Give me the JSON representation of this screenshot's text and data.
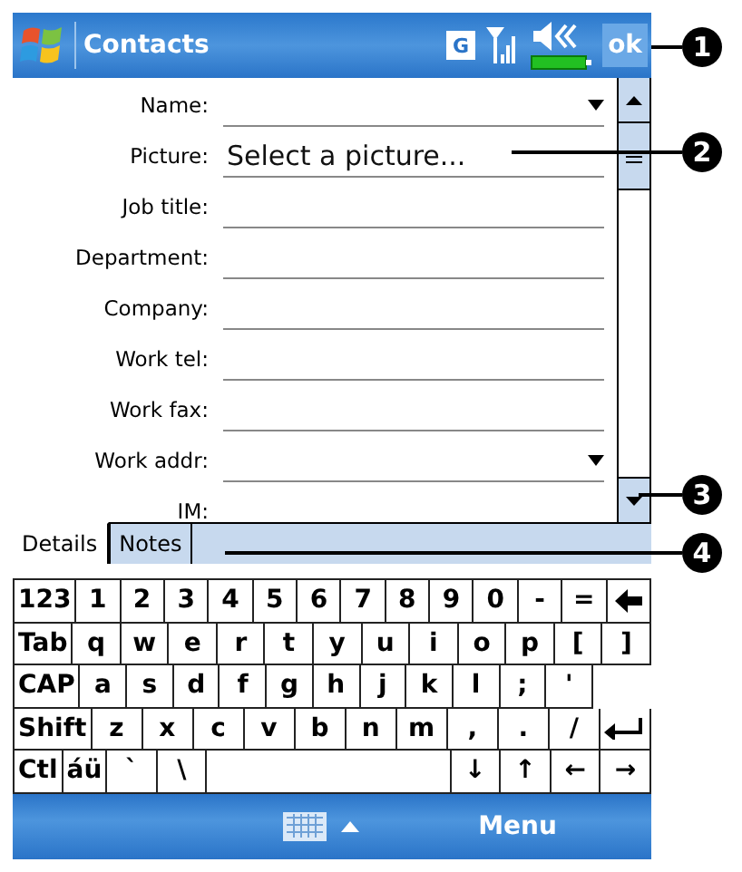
{
  "title_bar": {
    "title": "Contacts",
    "indicator": "G",
    "ok": "ok"
  },
  "fields": [
    {
      "label": "Name:",
      "dropdown": true
    },
    {
      "label": "Picture:",
      "value": "Select a picture..."
    },
    {
      "label": "Job title:"
    },
    {
      "label": "Department:"
    },
    {
      "label": "Company:"
    },
    {
      "label": "Work tel:"
    },
    {
      "label": "Work fax:"
    },
    {
      "label": "Work addr:",
      "dropdown": true
    },
    {
      "label": "IM:"
    }
  ],
  "tabs": [
    {
      "label": "Details",
      "selected": true
    },
    {
      "label": "Notes",
      "selected": false
    }
  ],
  "keyboard": [
    [
      {
        "kind": "modifier",
        "label": "123"
      },
      {
        "kind": "char",
        "label": "1"
      },
      {
        "kind": "char",
        "label": "2"
      },
      {
        "kind": "char",
        "label": "3"
      },
      {
        "kind": "char",
        "label": "4"
      },
      {
        "kind": "char",
        "label": "5"
      },
      {
        "kind": "char",
        "label": "6"
      },
      {
        "kind": "char",
        "label": "7"
      },
      {
        "kind": "char",
        "label": "8"
      },
      {
        "kind": "char",
        "label": "9"
      },
      {
        "kind": "char",
        "label": "0"
      },
      {
        "kind": "char",
        "label": "-"
      },
      {
        "kind": "char",
        "label": "="
      },
      {
        "kind": "backspace"
      }
    ],
    [
      {
        "kind": "modifier",
        "label": "Tab"
      },
      {
        "kind": "char",
        "label": "q"
      },
      {
        "kind": "char",
        "label": "w"
      },
      {
        "kind": "char",
        "label": "e"
      },
      {
        "kind": "char",
        "label": "r"
      },
      {
        "kind": "char",
        "label": "t"
      },
      {
        "kind": "char",
        "label": "y"
      },
      {
        "kind": "char",
        "label": "u"
      },
      {
        "kind": "char",
        "label": "i"
      },
      {
        "kind": "char",
        "label": "o"
      },
      {
        "kind": "char",
        "label": "p"
      },
      {
        "kind": "char",
        "label": "["
      },
      {
        "kind": "char",
        "label": "]"
      }
    ],
    [
      {
        "kind": "modifier",
        "label": "CAP"
      },
      {
        "kind": "char",
        "label": "a"
      },
      {
        "kind": "char",
        "label": "s"
      },
      {
        "kind": "char",
        "label": "d"
      },
      {
        "kind": "char",
        "label": "f"
      },
      {
        "kind": "char",
        "label": "g"
      },
      {
        "kind": "char",
        "label": "h"
      },
      {
        "kind": "char",
        "label": "j"
      },
      {
        "kind": "char",
        "label": "k"
      },
      {
        "kind": "char",
        "label": "l"
      },
      {
        "kind": "char",
        "label": ";"
      },
      {
        "kind": "char",
        "label": "'"
      },
      {
        "kind": "gap"
      }
    ],
    [
      {
        "kind": "modifier",
        "label": "Shift"
      },
      {
        "kind": "char",
        "label": "z"
      },
      {
        "kind": "char",
        "label": "x"
      },
      {
        "kind": "char",
        "label": "c"
      },
      {
        "kind": "char",
        "label": "v"
      },
      {
        "kind": "char",
        "label": "b"
      },
      {
        "kind": "char",
        "label": "n"
      },
      {
        "kind": "char",
        "label": "m"
      },
      {
        "kind": "char",
        "label": ","
      },
      {
        "kind": "char",
        "label": "."
      },
      {
        "kind": "char",
        "label": "/"
      },
      {
        "kind": "enter"
      }
    ],
    [
      {
        "kind": "modifier",
        "label": "Ctl"
      },
      {
        "kind": "modifier",
        "label": "áü"
      },
      {
        "kind": "char",
        "label": "`"
      },
      {
        "kind": "char",
        "label": "\\"
      },
      {
        "kind": "space"
      },
      {
        "kind": "char",
        "label": "↓"
      },
      {
        "kind": "char",
        "label": "↑"
      },
      {
        "kind": "char",
        "label": "←"
      },
      {
        "kind": "char",
        "label": "→"
      }
    ]
  ],
  "menu_bar": {
    "menu": "Menu"
  },
  "callouts": [
    {
      "number": "1"
    },
    {
      "number": "2"
    },
    {
      "number": "3"
    },
    {
      "number": "4"
    }
  ]
}
